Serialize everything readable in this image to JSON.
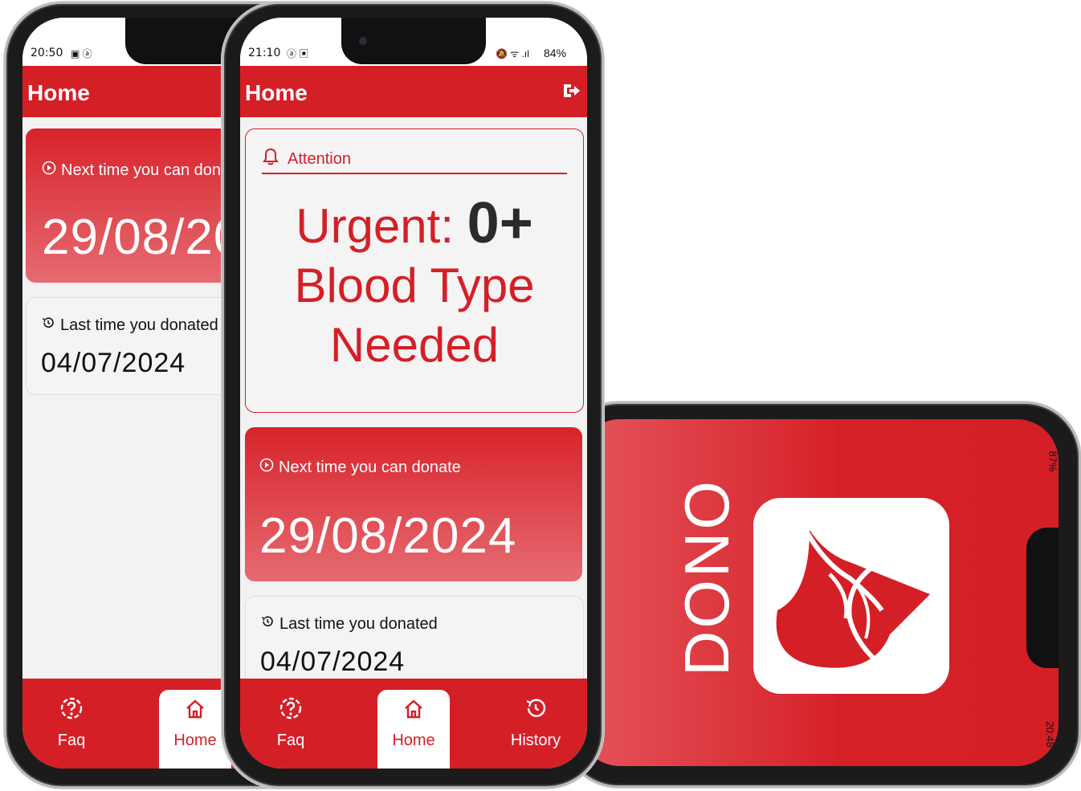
{
  "phone1": {
    "status_time": "20:50",
    "app_title": "Home",
    "next_label": "Next time you can donate",
    "next_date": "29/08/2024",
    "last_label": "Last time you donated",
    "last_date": "04/07/2024",
    "nav": {
      "faq": "Faq",
      "home": "Home"
    }
  },
  "phone2": {
    "status_time": "21:10",
    "battery": "84%",
    "app_title": "Home",
    "attention_label": "Attention",
    "urgent_prefix": "Urgent:",
    "blood_type": "0+",
    "urgent_line2": "Blood Type",
    "urgent_line3": "Needed",
    "next_label": "Next time you can donate",
    "next_date": "29/08/2024",
    "last_label": "Last time you donated",
    "last_date": "04/07/2024",
    "nav": {
      "faq": "Faq",
      "home": "Home",
      "history": "History"
    }
  },
  "phone3": {
    "app_name": "DONO",
    "status_time": "20:48",
    "battery": "87%"
  },
  "colors": {
    "primary": "#d51f26",
    "text_dark": "#111111",
    "bg": "#f2f2f2"
  }
}
